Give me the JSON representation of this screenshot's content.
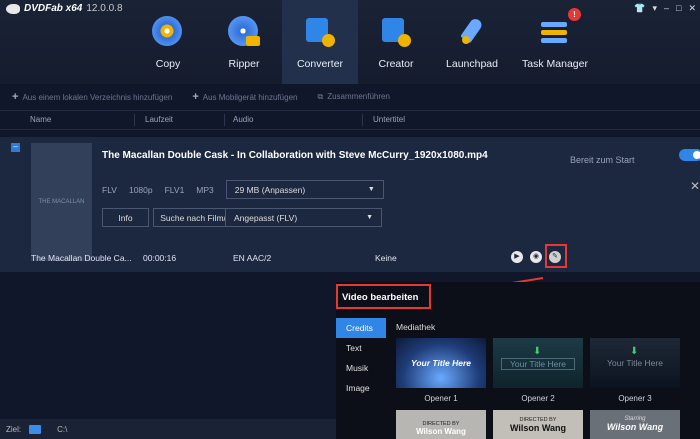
{
  "app": {
    "name": "DVDFab x64",
    "version": "12.0.0.8"
  },
  "modules": [
    {
      "label": "Copy",
      "icon": "copy-disc-icon"
    },
    {
      "label": "Ripper",
      "icon": "ripper-disc-icon"
    },
    {
      "label": "Converter",
      "icon": "converter-film-icon"
    },
    {
      "label": "Creator",
      "icon": "creator-film-icon"
    },
    {
      "label": "Launchpad",
      "icon": "rocket-icon"
    },
    {
      "label": "Task Manager",
      "icon": "task-list-icon",
      "badge": "!"
    }
  ],
  "toolbar": {
    "add_local": "Aus einem lokalen Verzeichnis hinzufügen",
    "add_mobile": "Aus Mobilgerät hinzufügen",
    "merge": "Zusammenführen"
  },
  "columns": [
    "Name",
    "Laufzeit",
    "Audio",
    "Untertitel"
  ],
  "item": {
    "title": "The Macallan Double Cask - In Collaboration with Steve McCurry_1920x1080.mp4",
    "thumb_text": "THE MACALLAN",
    "meta": [
      "FLV",
      "1080p",
      "FLV1",
      "MP3"
    ],
    "size": "29 MB (Anpassen)",
    "info_button": "Info",
    "search_button": "Suche nach Film/TV",
    "profile": "Angepasst (FLV)",
    "status": "Bereit zum Start",
    "row_name": "The Macallan Double Ca...",
    "row_duration": "00:00:16",
    "row_audio": "EN  AAC/2",
    "row_subtitle": "Keine"
  },
  "panel": {
    "title": "Video bearbeiten",
    "tabs": [
      "Credits",
      "Text",
      "Musik",
      "Image"
    ],
    "library": "Mediathek",
    "tiles": [
      {
        "text": "Your Title Here",
        "caption": "Opener 1"
      },
      {
        "text": "Your Title Here",
        "caption": "Opener 2"
      },
      {
        "text": "Your Title Here",
        "caption": "Opener 3"
      },
      {
        "text": "DIRECTED BY",
        "name": "Wilson Wang"
      },
      {
        "text": "DIRECTED BY",
        "name": "Wilson Wang"
      },
      {
        "text": "Starring",
        "name": "Wilson Wang"
      }
    ]
  },
  "footer": {
    "label": "Ziel:",
    "path": "C:\\"
  },
  "colors": {
    "accent": "#2f86e6",
    "highlight": "#e53935"
  }
}
